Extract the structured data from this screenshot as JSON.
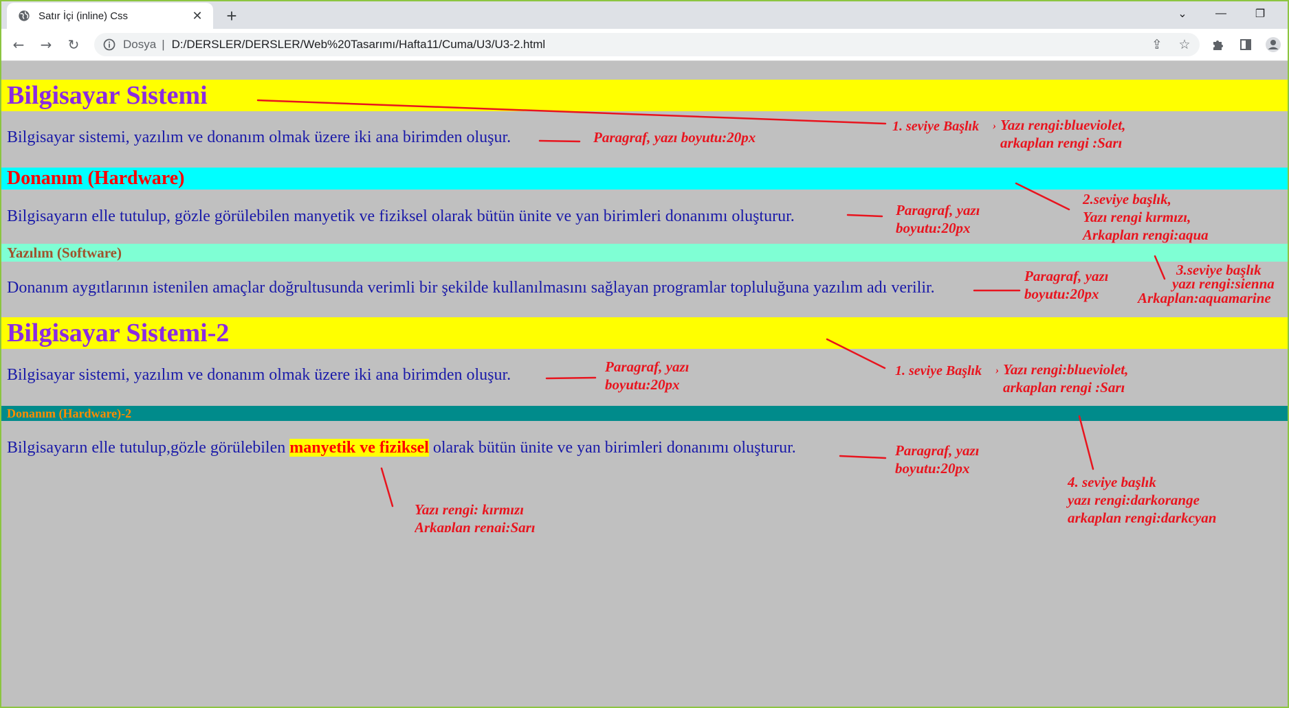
{
  "browser": {
    "tab_title": "Satır İçi (inline) Css",
    "tab_close": "✕",
    "new_tab": "+",
    "omnibox_scheme": "Dosya",
    "omnibox_separator": "|",
    "url": "D:/DERSLER/DERSLER/Web%20Tasarımı/Hafta11/Cuma/U3/U3-2.html",
    "window_controls": [
      "⌄",
      "—",
      "❐"
    ],
    "nav_icons": [
      "back-icon",
      "forward-icon",
      "reload-icon"
    ],
    "toolbar_icons": [
      "share-icon",
      "star-icon",
      "extensions-icon",
      "side-panel-icon",
      "profile-icon"
    ]
  },
  "content": {
    "h1_a": "Bilgisayar Sistemi",
    "p1": "Bilgisayar sistemi, yazılım ve donanım olmak üzere iki ana birimden oluşur.",
    "h2": "Donanım (Hardware)",
    "p2": "Bilgisayarın elle tutulup, gözle görülebilen manyetik ve fiziksel olarak bütün ünite ve yan birimleri donanımı oluşturur.",
    "h3": "Yazılım (Software)",
    "p3": "Donanım aygıtlarının istenilen amaçlar doğrultusunda verimli bir şekilde kullanılmasını sağlayan programlar topluluğuna yazılım adı verilir.",
    "h1_b": "Bilgisayar Sistemi-2",
    "p4": "Bilgisayar sistemi, yazılım ve donanım olmak üzere iki ana birimden oluşur.",
    "h4": "Donanım (Hardware)-2",
    "p5_before": "Bilgisayarın elle tutulup,gözle görülebilen ",
    "p5_highlight": "manyetik ve fiziksel",
    "p5_after": " olarak bütün ünite ve yan birimleri donanımı oluşturur."
  },
  "annotations": {
    "n1_title": "1. seviye Başlık",
    "n1_comma": "›",
    "n1_line1": "Yazı rengi:blueviolet,",
    "n1_line2": "arkaplan rengi :Sarı",
    "n2_line1": "Paragraf, yazı boyutu:20px",
    "n3_line1": "Paragraf, yazı",
    "n3_line2": "boyutu:20px",
    "n4_line1": "2.seviye başlık,",
    "n4_line2": "Yazı rengi kırmızı,",
    "n4_line3": "Arkaplan rengi:aqua",
    "n5_line1": "Paragraf, yazı",
    "n5_line2": "boyutu:20px",
    "n6_line1": "3.seviye başlık",
    "n6_line2": "yazı rengi:sienna",
    "n6_line3": "Arkaplan:aquamarine",
    "n7_title": "1. seviye Başlık",
    "n7_comma": "›",
    "n7_line1": "Yazı rengi:blueviolet,",
    "n7_line2": "arkaplan rengi :Sarı",
    "n8_line1": "Paragraf, yazı",
    "n8_line2": "boyutu:20px",
    "n9_line1": "Paragraf, yazı",
    "n9_line2": "boyutu:20px",
    "n10_line1": "4. seviye başlık",
    "n10_line2": "yazı rengi:darkorange",
    "n10_line3": "arkaplan rengi:darkcyan",
    "n11_line1": "Yazı rengi: kırmızı",
    "n11_line2": "Arkaplan rengi:Sarı"
  },
  "colors": {
    "h1": "#8a2be2",
    "h1_bg": "#ffff00",
    "h2": "#ff0000",
    "h2_bg": "#00ffff",
    "h3": "#a0522d",
    "h3_bg": "#7fffd4",
    "h4": "#ff8c00",
    "h4_bg": "#008b8b",
    "annotation": "#e8141e",
    "page_bg": "#c0c0c0"
  }
}
